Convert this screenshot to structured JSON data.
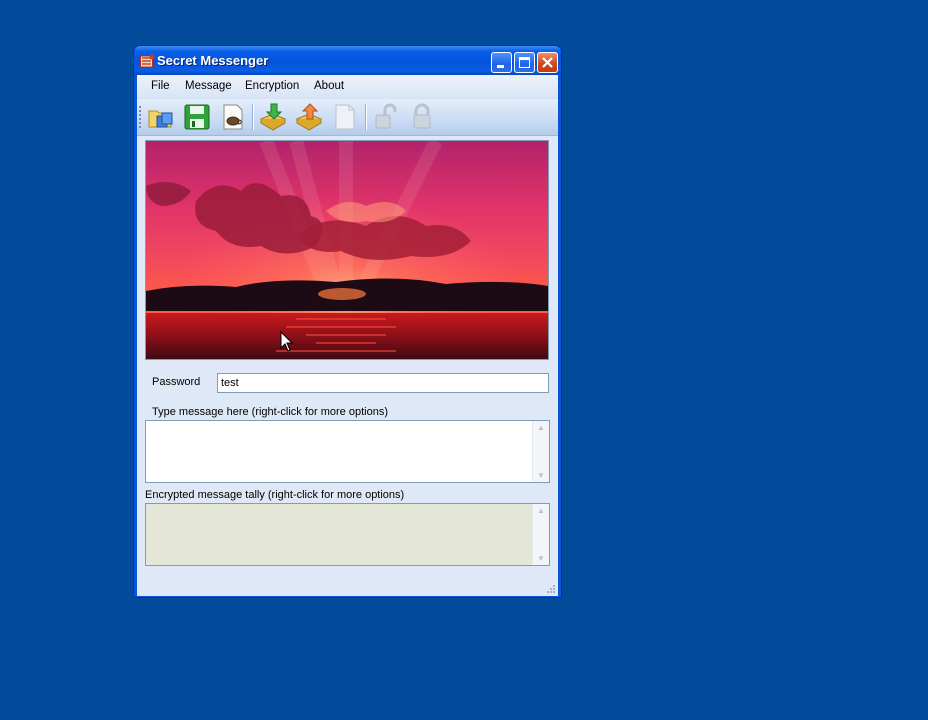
{
  "window": {
    "title": "Secret Messenger",
    "minimize_label": "minimize",
    "maximize_label": "maximize",
    "close_label": "close"
  },
  "menu": {
    "items": [
      {
        "label": "File"
      },
      {
        "label": "Message"
      },
      {
        "label": "Encryption"
      },
      {
        "label": "About"
      }
    ]
  },
  "toolbar": {
    "icons": [
      "open-folder-icon",
      "save-disk-icon",
      "coffee-document-icon",
      "import-arrow-icon",
      "export-arrow-icon",
      "blank-document-icon",
      "unlock-icon",
      "lock-icon"
    ]
  },
  "image": {
    "subject": "sunset-over-water-image"
  },
  "form": {
    "password_label": "Password",
    "password_value": "test",
    "message_label": "Type message here (right-click for more options)",
    "message_value": "",
    "encrypted_label": "Encrypted message tally (right-click for more options)",
    "encrypted_value": ""
  },
  "colors": {
    "desktop": "#024a9a",
    "titlebar": "#0553dc",
    "client": "#dfe8f6",
    "readonly_field": "#e4e6d8"
  }
}
